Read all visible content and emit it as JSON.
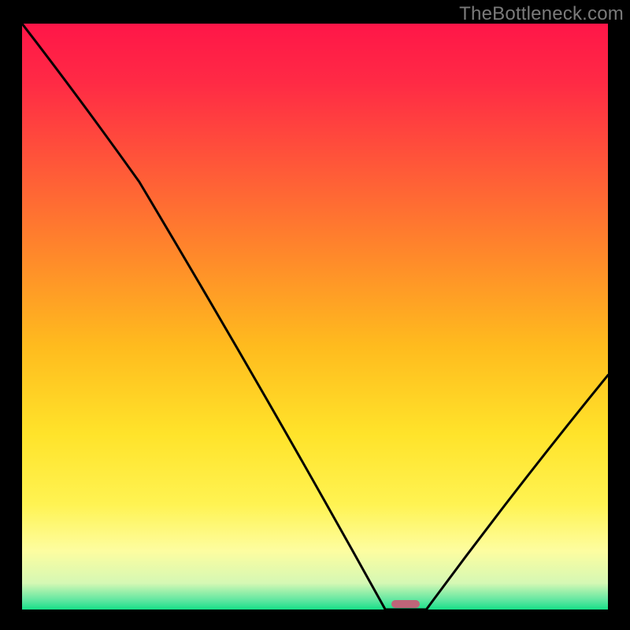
{
  "watermark": "TheBottleneck.com",
  "colors": {
    "background": "#000000",
    "gradient_stops": [
      {
        "offset": 0.0,
        "color": "#ff1648"
      },
      {
        "offset": 0.1,
        "color": "#ff2a45"
      },
      {
        "offset": 0.25,
        "color": "#ff5a38"
      },
      {
        "offset": 0.4,
        "color": "#ff8a2a"
      },
      {
        "offset": 0.55,
        "color": "#ffbb1e"
      },
      {
        "offset": 0.7,
        "color": "#ffe32a"
      },
      {
        "offset": 0.82,
        "color": "#fff352"
      },
      {
        "offset": 0.9,
        "color": "#fdfda0"
      },
      {
        "offset": 0.955,
        "color": "#d5f8b4"
      },
      {
        "offset": 0.985,
        "color": "#5ce6a0"
      },
      {
        "offset": 1.0,
        "color": "#17e087"
      }
    ],
    "curve": "#000000",
    "marker": "#be6579"
  },
  "chart_data": {
    "type": "line",
    "title": "",
    "xlabel": "",
    "ylabel": "",
    "xlim": [
      0,
      100
    ],
    "ylim": [
      0,
      100
    ],
    "series": [
      {
        "name": "bottleneck-curve",
        "x": [
          0,
          20,
          62,
          69,
          100
        ],
        "y": [
          100,
          73,
          0,
          0,
          40
        ]
      }
    ],
    "annotations": [
      {
        "name": "optimal-marker",
        "x": 65.5,
        "y": 0.9
      }
    ]
  }
}
